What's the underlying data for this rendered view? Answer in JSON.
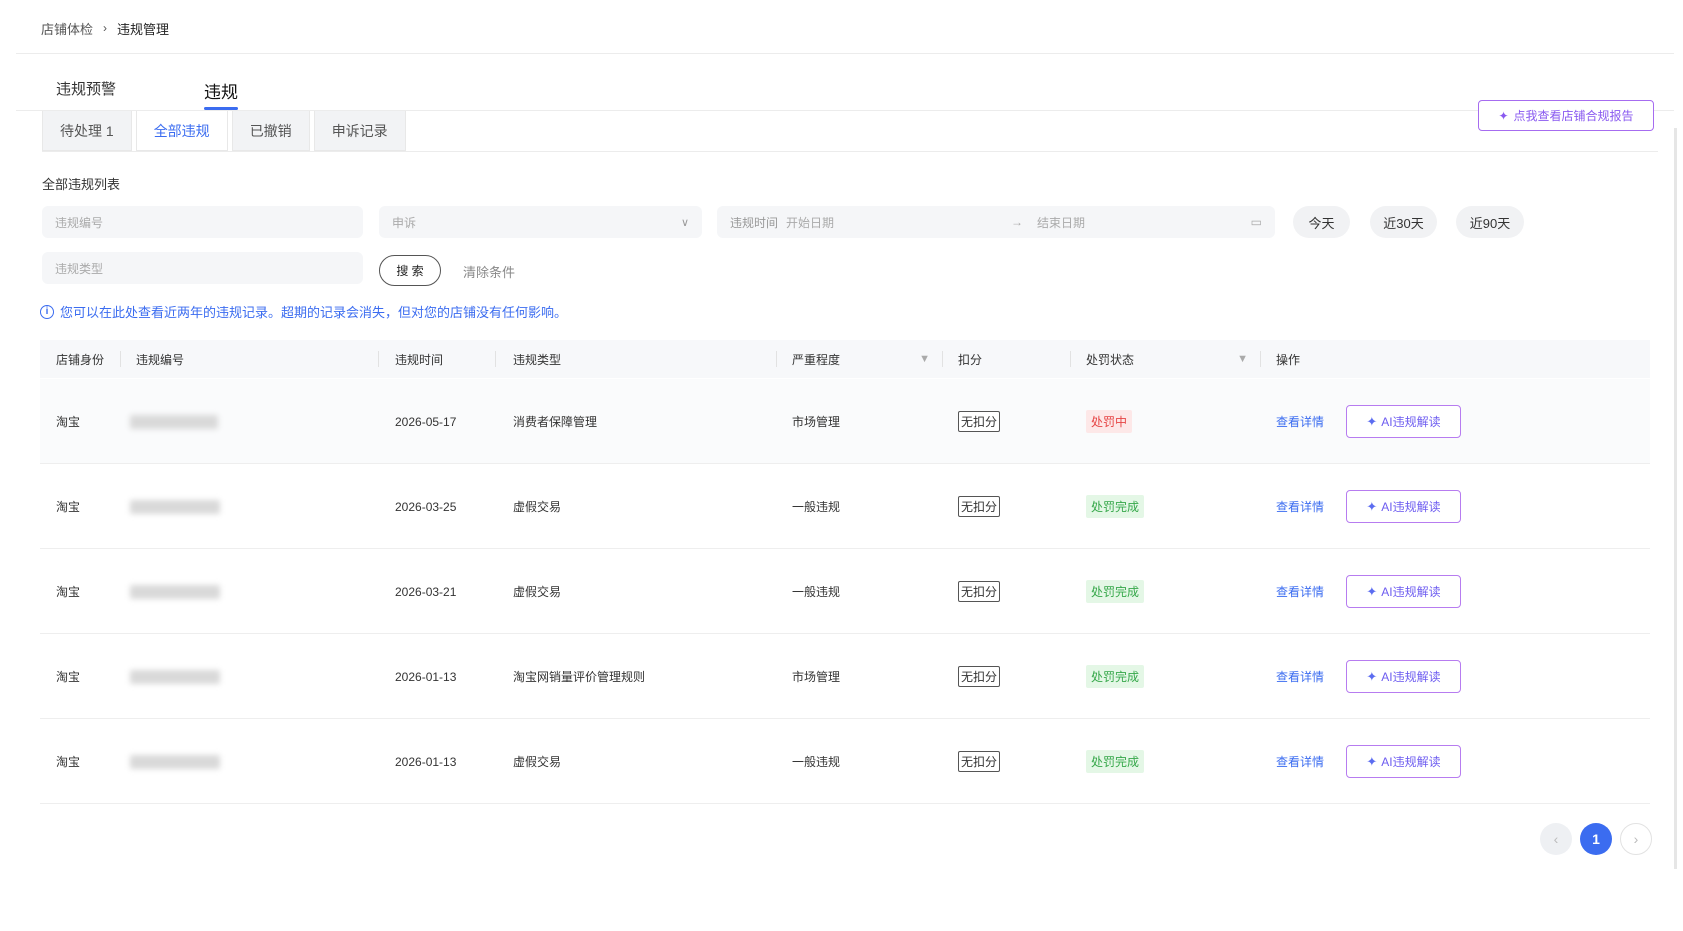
{
  "breadcrumb": {
    "parent": "店铺体检",
    "separator": "›",
    "current": "违规管理"
  },
  "main_tabs": [
    {
      "label": "违规预警"
    },
    {
      "label": "违规"
    }
  ],
  "sub_tabs": [
    {
      "label": "待处理 1"
    },
    {
      "label": "全部违规"
    },
    {
      "label": "已撤销"
    },
    {
      "label": "申诉记录"
    }
  ],
  "report_button": {
    "icon": "sparkle-icon",
    "label": "点我查看店铺合规报告"
  },
  "list_title": "全部违规列表",
  "filters": {
    "violation_id_placeholder": "违规编号",
    "appeal_placeholder": "申诉",
    "time_label": "违规时间",
    "start_placeholder": "开始日期",
    "range_arrow": "→",
    "end_placeholder": "结束日期",
    "violation_type_placeholder": "违规类型"
  },
  "quick_ranges": [
    "今天",
    "近30天",
    "近90天"
  ],
  "search_label": "搜 索",
  "clear_label": "清除条件",
  "notice": "您可以在此处查看近两年的违规记录。超期的记录会消失，但对您的店铺没有任何影响。",
  "columns": [
    "店铺身份",
    "违规编号",
    "违规时间",
    "违规类型",
    "严重程度",
    "扣分",
    "处罚状态",
    "操作"
  ],
  "rows": [
    {
      "store": "淘宝",
      "time": "2026-05-17",
      "type": "消费者保障管理",
      "severity": "市场管理",
      "points": "无扣分",
      "status": "处罚中",
      "status_kind": "pending",
      "detail": "查看详情",
      "ai": "AI违规解读"
    },
    {
      "store": "淘宝",
      "time": "2026-03-25",
      "type": "虚假交易",
      "severity": "一般违规",
      "points": "无扣分",
      "status": "处罚完成",
      "status_kind": "done",
      "detail": "查看详情",
      "ai": "AI违规解读"
    },
    {
      "store": "淘宝",
      "time": "2026-03-21",
      "type": "虚假交易",
      "severity": "一般违规",
      "points": "无扣分",
      "status": "处罚完成",
      "status_kind": "done",
      "detail": "查看详情",
      "ai": "AI违规解读"
    },
    {
      "store": "淘宝",
      "time": "2026-01-13",
      "type": "淘宝网销量评价管理规则",
      "severity": "市场管理",
      "points": "无扣分",
      "status": "处罚完成",
      "status_kind": "done",
      "detail": "查看详情",
      "ai": "AI违规解读"
    },
    {
      "store": "淘宝",
      "time": "2026-01-13",
      "type": "虚假交易",
      "severity": "一般违规",
      "points": "无扣分",
      "status": "处罚完成",
      "status_kind": "done",
      "detail": "查看详情",
      "ai": "AI违规解读"
    }
  ],
  "pagination": {
    "prev": "‹",
    "current": "1",
    "next": "›"
  }
}
